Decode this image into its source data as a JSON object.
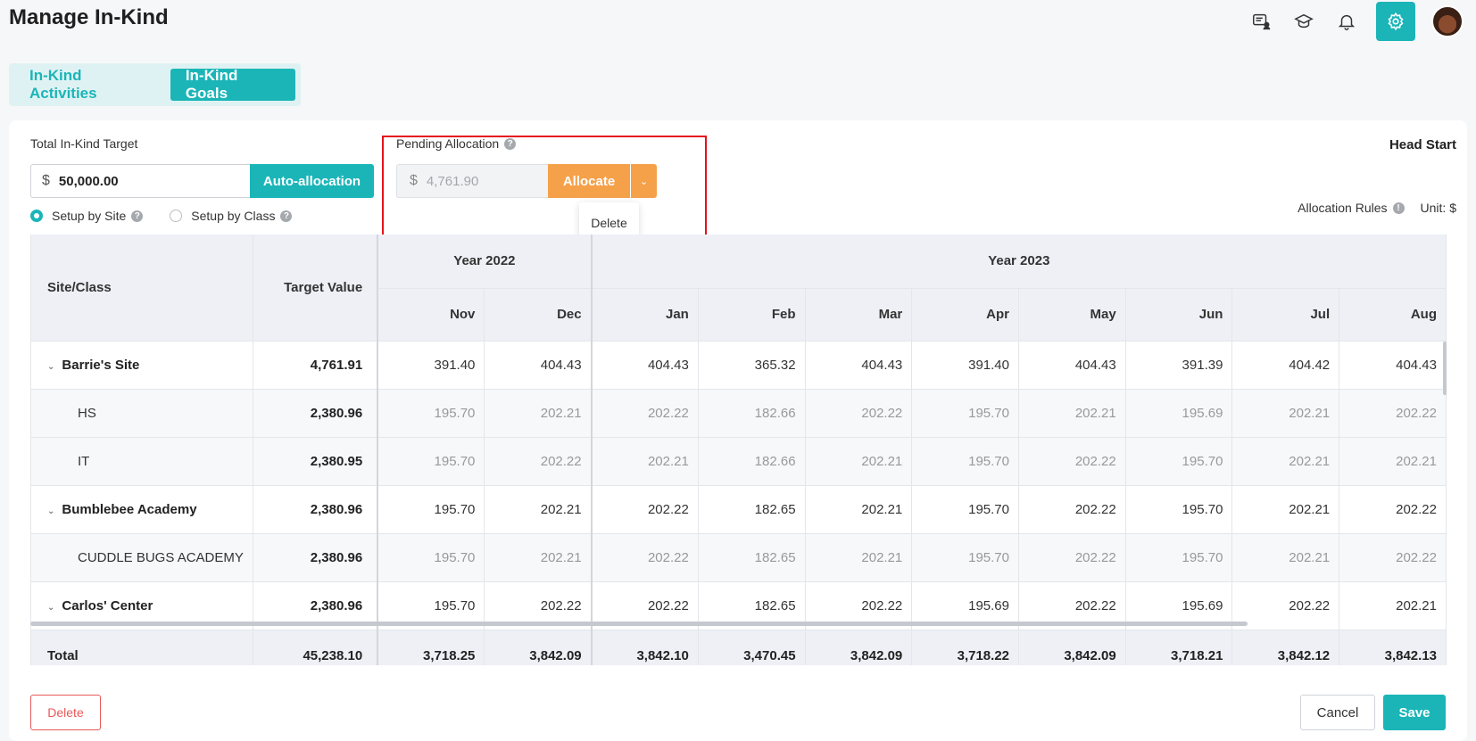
{
  "header": {
    "title": "Manage In-Kind",
    "icons": [
      "chat-user-icon",
      "graduation-cap-icon",
      "bell-icon",
      "gear-icon",
      "avatar"
    ]
  },
  "tabs": [
    {
      "label": "In-Kind Activities",
      "active": false
    },
    {
      "label": "In-Kind Goals",
      "active": true
    }
  ],
  "form": {
    "total_label": "Total In-Kind Target",
    "currency": "$",
    "total_value": "50,000.00",
    "auto_allocation": "Auto-allocation",
    "setup_by_site": "Setup by Site",
    "setup_by_class": "Setup by Class",
    "pending_label": "Pending Allocation",
    "pending_value": "4,761.90",
    "allocate": "Allocate",
    "dropdown_delete": "Delete",
    "program": "Head Start",
    "allocation_rules": "Allocation Rules",
    "unit": "Unit: $"
  },
  "table": {
    "col_site": "Site/Class",
    "col_target": "Target Value",
    "year_2022": "Year 2022",
    "year_2023": "Year 2023",
    "months": [
      "Nov",
      "Dec",
      "Jan",
      "Feb",
      "Mar",
      "Apr",
      "May",
      "Jun",
      "Jul",
      "Aug"
    ],
    "rows": [
      {
        "name": "Barrie's Site",
        "level": "site",
        "target": "4,761.91",
        "values": [
          "391.40",
          "404.43",
          "404.43",
          "365.32",
          "404.43",
          "391.40",
          "404.43",
          "391.39",
          "404.42",
          "404.43"
        ]
      },
      {
        "name": "HS",
        "level": "class",
        "target": "2,380.96",
        "values": [
          "195.70",
          "202.21",
          "202.22",
          "182.66",
          "202.22",
          "195.70",
          "202.21",
          "195.69",
          "202.21",
          "202.22"
        ]
      },
      {
        "name": "IT",
        "level": "class",
        "target": "2,380.95",
        "values": [
          "195.70",
          "202.22",
          "202.21",
          "182.66",
          "202.21",
          "195.70",
          "202.22",
          "195.70",
          "202.21",
          "202.21"
        ]
      },
      {
        "name": "Bumblebee Academy",
        "level": "site",
        "target": "2,380.96",
        "values": [
          "195.70",
          "202.21",
          "202.22",
          "182.65",
          "202.21",
          "195.70",
          "202.22",
          "195.70",
          "202.21",
          "202.22"
        ]
      },
      {
        "name": "CUDDLE BUGS ACADEMY",
        "level": "class",
        "target": "2,380.96",
        "values": [
          "195.70",
          "202.21",
          "202.22",
          "182.65",
          "202.21",
          "195.70",
          "202.22",
          "195.70",
          "202.21",
          "202.22"
        ]
      },
      {
        "name": "Carlos' Center",
        "level": "site",
        "target": "2,380.96",
        "values": [
          "195.70",
          "202.22",
          "202.22",
          "182.65",
          "202.22",
          "195.69",
          "202.22",
          "195.69",
          "202.22",
          "202.21"
        ]
      }
    ],
    "total": {
      "label": "Total",
      "target": "45,238.10",
      "values": [
        "3,718.25",
        "3,842.09",
        "3,842.10",
        "3,470.45",
        "3,842.09",
        "3,718.22",
        "3,842.09",
        "3,718.21",
        "3,842.12",
        "3,842.13"
      ]
    }
  },
  "footer": {
    "delete": "Delete",
    "cancel": "Cancel",
    "save": "Save"
  }
}
